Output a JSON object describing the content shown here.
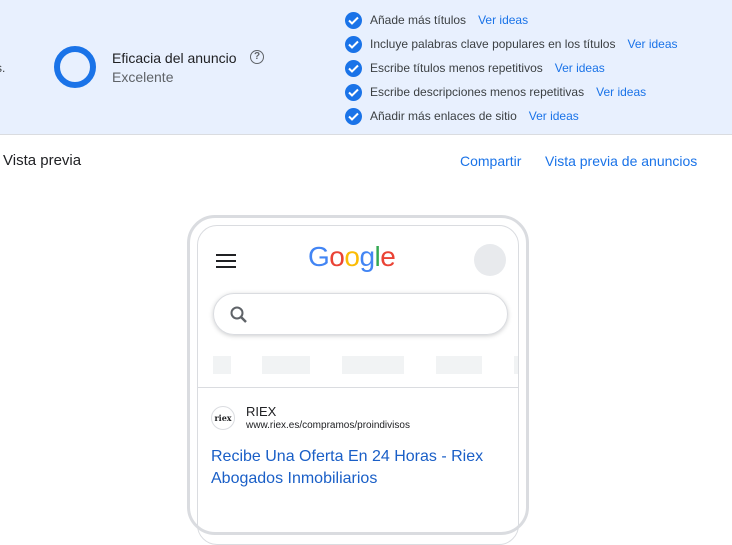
{
  "banner": {
    "cut_text": "s.",
    "ad_strength_label": "Eficacia del anuncio",
    "help_icon": "help-circle-icon",
    "ad_strength_value": "Excelente",
    "suggestions": [
      {
        "text": "Añade más títulos",
        "link": "Ver ideas"
      },
      {
        "text": "Incluye palabras clave populares en los títulos",
        "link": "Ver ideas"
      },
      {
        "text": "Escribe títulos menos repetitivos",
        "link": "Ver ideas"
      },
      {
        "text": "Escribe descripciones menos repetitivas",
        "link": "Ver ideas"
      },
      {
        "text": "Añadir más enlaces de sitio",
        "link": "Ver ideas"
      }
    ]
  },
  "preview": {
    "title": "Vista previa",
    "share_label": "Compartir",
    "ads_preview_label": "Vista previa de anuncios"
  },
  "phone": {
    "logo": "Google",
    "search_placeholder": "",
    "ad": {
      "favicon_text": "riex",
      "advertiser": "RIEX",
      "display_url": "www.riex.es/compramos/proindivisos",
      "headline": "Recibe Una Oferta En 24 Horas - Riex Abogados Inmobiliarios"
    }
  },
  "colors": {
    "accent": "#1a73e8",
    "banner_bg": "#e8f0fe"
  }
}
